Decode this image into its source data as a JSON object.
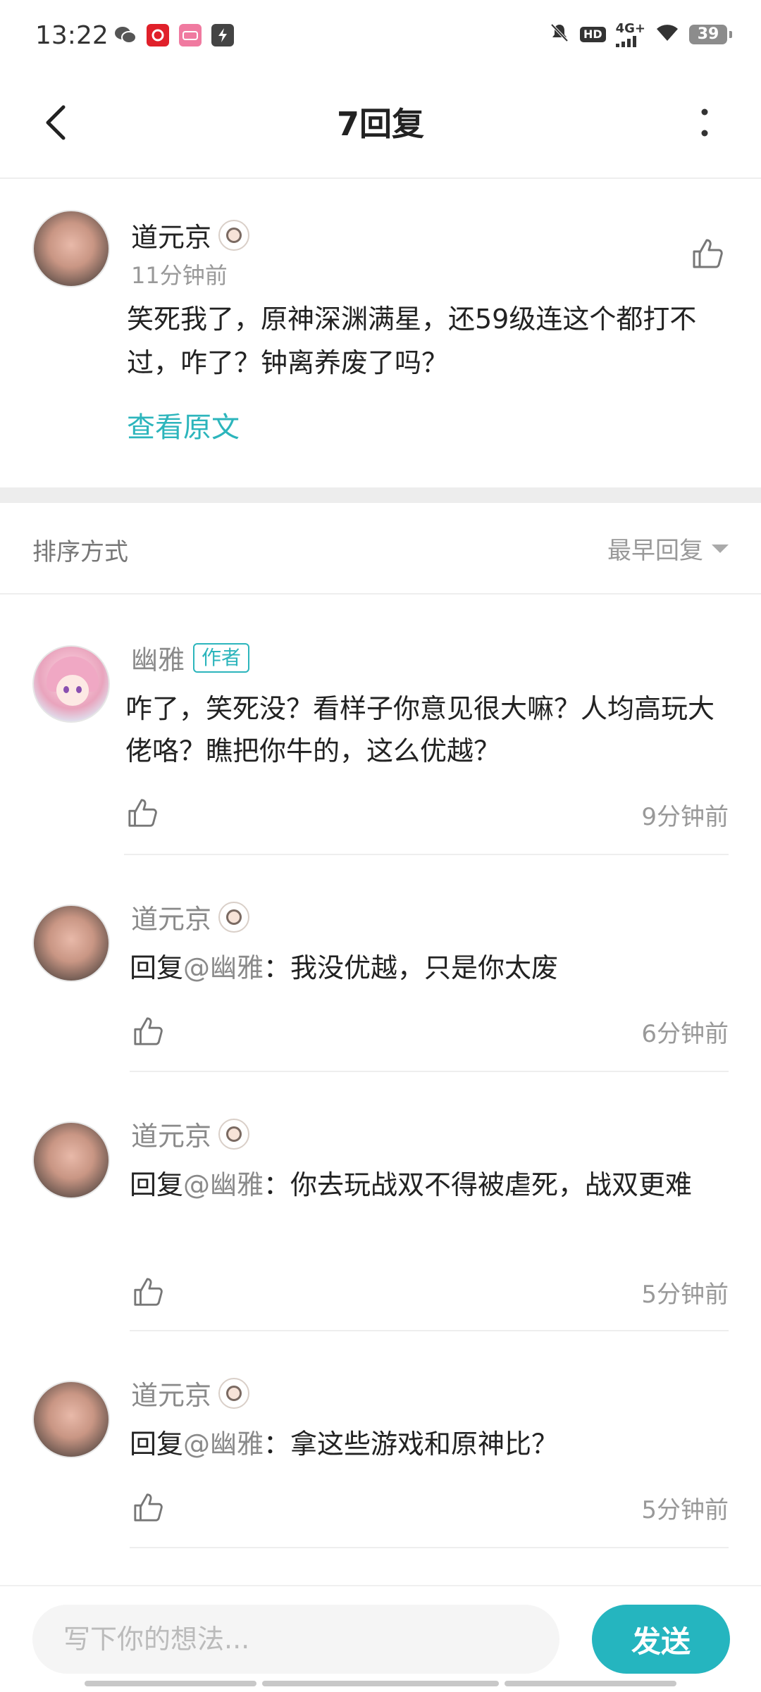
{
  "status_bar": {
    "time": "13:22",
    "apps": [
      {
        "icon": "wechat-icon",
        "color": "#555555"
      },
      {
        "icon": "netease-music-icon",
        "color": "#e0202a"
      },
      {
        "icon": "bilibili-icon",
        "color": "#f07aa0"
      },
      {
        "icon": "flash-app-icon",
        "color": "#444444"
      }
    ],
    "hd_label": "HD",
    "network_label": "4G+",
    "battery": "39"
  },
  "header": {
    "title": "7回复"
  },
  "post": {
    "author": "道元京",
    "time": "11分钟前",
    "text": "笑死我了，原神深渊满星，还59级连这个都打不过，咋了？钟离养废了吗？",
    "view_original": "查看原文"
  },
  "sort": {
    "label": "排序方式",
    "selected": "最早回复"
  },
  "replies": [
    {
      "author": "幽雅",
      "author_tag": "作者",
      "prefix": "",
      "mention": "",
      "text": "咋了，笑死没？看样子你意见很大嘛？人均高玩大佬咯？瞧把你牛的，这么优越？",
      "time": "9分钟前"
    },
    {
      "author": "道元京",
      "prefix": "回复",
      "mention": "@幽雅",
      "text": "：我没优越，只是你太废",
      "time": "6分钟前"
    },
    {
      "author": "道元京",
      "prefix": "回复",
      "mention": "@幽雅",
      "text": "：你去玩战双不得被虐死，战双更难",
      "time": "5分钟前"
    },
    {
      "author": "道元京",
      "prefix": "回复",
      "mention": "@幽雅",
      "text": "：拿这些游戏和原神比？",
      "time": "5分钟前"
    }
  ],
  "composer": {
    "placeholder": "写下你的想法...",
    "send_label": "发送"
  },
  "colors": {
    "accent": "#25b5bf",
    "link": "#2cb5bc",
    "muted": "#999999"
  }
}
